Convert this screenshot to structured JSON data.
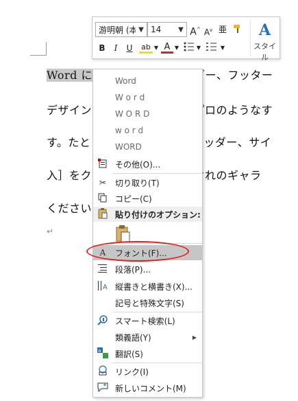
{
  "document": {
    "lines": [
      {
        "selected": "Word に用意されている",
        "rest": "ヘッダー、フッター"
      },
      {
        "selected": "",
        "rest": "デザイン　　　　　　　　、プロのようなす"
      },
      {
        "selected": "",
        "rest": "す。たと　　　　　　　氏、ヘッダー、サイ"
      },
      {
        "selected": "",
        "rest": "入］をク　　　　　　　それぞれのギャラ"
      },
      {
        "selected": "",
        "rest": "ください"
      }
    ],
    "para_mark": "↵"
  },
  "mini_toolbar": {
    "font_name": "游明朝 (本",
    "font_size": "14",
    "grow_label": "A",
    "shrink_label": "A",
    "phonetic_label": "亜",
    "bold": "B",
    "italic": "I",
    "underline": "U",
    "highlight_label": "ab",
    "font_color_label": "A",
    "style_icon": "A",
    "style_label": "スタイル",
    "colors": {
      "highlight": "#f5e000",
      "font_color": "#e0201f",
      "style_blue": "#2e6bb8"
    }
  },
  "menu": {
    "items": [
      {
        "label": "Word",
        "icon": ""
      },
      {
        "label": "W o r d",
        "icon": ""
      },
      {
        "label": "W O R D",
        "icon": ""
      },
      {
        "label": "w o r d",
        "icon": ""
      },
      {
        "label": "WORD",
        "icon": ""
      },
      {
        "label": "その他(O)...",
        "icon": "more-icon"
      },
      {
        "label": "切り取り(T)",
        "icon": "cut-icon"
      },
      {
        "label": "コピー(C)",
        "icon": "copy-icon"
      },
      {
        "label": "貼り付けのオプション:",
        "icon": "paste-icon"
      },
      {
        "label": "フォント(F)...",
        "icon": "font-icon"
      },
      {
        "label": "段落(P)...",
        "icon": "paragraph-icon"
      },
      {
        "label": "縦書きと横書き(X)...",
        "icon": "text-direction-icon"
      },
      {
        "label": "記号と特殊文字(S)",
        "icon": ""
      },
      {
        "label": "スマート検索(L)",
        "icon": "smart-lookup-icon"
      },
      {
        "label": "類義語(Y)",
        "icon": ""
      },
      {
        "label": "翻訳(S)",
        "icon": "translate-icon"
      },
      {
        "label": "リンク(I)",
        "icon": "link-icon"
      },
      {
        "label": "新しいコメント(M)",
        "icon": "comment-icon"
      }
    ]
  }
}
